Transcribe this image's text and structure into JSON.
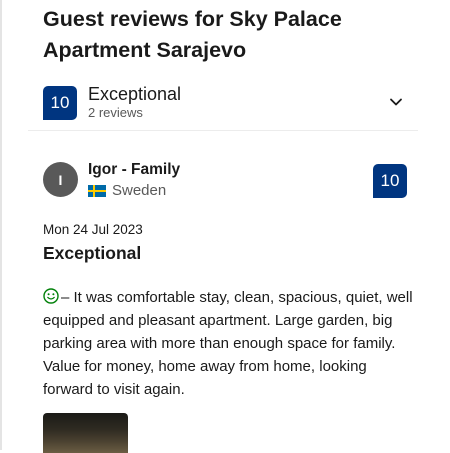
{
  "page": {
    "title": "Guest reviews for Sky Palace Apartment Sarajevo"
  },
  "summary": {
    "score": "10",
    "rating_word": "Exceptional",
    "review_count": "2 reviews"
  },
  "review": {
    "avatar_initial": "I",
    "reviewer_name": "Igor - Family",
    "country": "Sweden",
    "flag_icon": "sweden-flag-icon",
    "score": "10",
    "date": "Mon 24 Jul 2023",
    "title": "Exceptional",
    "positive_icon": "smiley-icon",
    "positive_text": "– It was comfortable stay, clean, spacious, quiet, well equipped and pleasant apartment. Large garden, big parking area with more than enough space for family. Value for money, home away from home, looking forward to visit again."
  },
  "colors": {
    "score_bg": "#003580",
    "smiley": "#008009",
    "secondary_text": "#595959"
  }
}
